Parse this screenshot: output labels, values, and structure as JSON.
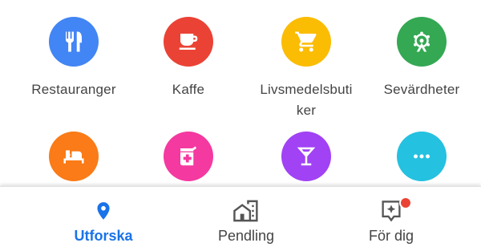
{
  "categories": [
    {
      "label": "Restauranger",
      "icon": "fork-knife-icon",
      "color": "#4285f4"
    },
    {
      "label": "Kaffe",
      "icon": "coffee-cup-icon",
      "color": "#ea4335"
    },
    {
      "label": "Livsmedelsbuti\nker",
      "icon": "shopping-cart-icon",
      "color": "#fbbc04"
    },
    {
      "label": "Sevärdheter",
      "icon": "landmark-icon",
      "color": "#34a853"
    },
    {
      "label": "",
      "icon": "hotel-bed-icon",
      "color": "#fa7b17"
    },
    {
      "label": "",
      "icon": "pharmacy-icon",
      "color": "#f439a0"
    },
    {
      "label": "",
      "icon": "cocktail-icon",
      "color": "#a142f4"
    },
    {
      "label": "",
      "icon": "more-icon",
      "color": "#24c1e0"
    }
  ],
  "bottom_nav": {
    "items": [
      {
        "label": "Utforska",
        "icon": "location-pin-icon",
        "active": true
      },
      {
        "label": "Pendling",
        "icon": "commute-icon",
        "active": false
      },
      {
        "label": "För dig",
        "icon": "for-you-icon",
        "active": false,
        "has_badge": true
      }
    ],
    "active_color": "#1a73e8",
    "badge_color": "#ea4335"
  }
}
